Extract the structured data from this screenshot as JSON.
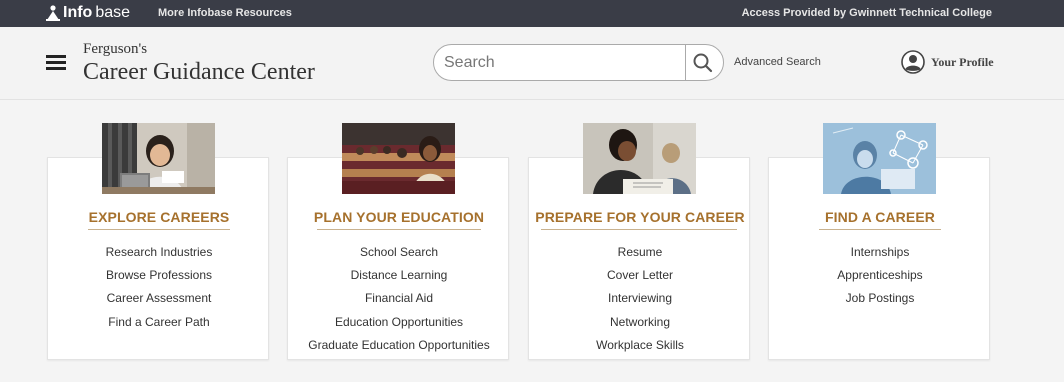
{
  "topbar": {
    "logo_bold": "Info",
    "logo_rest": "base",
    "more_resources": "More Infobase Resources",
    "access": "Access Provided by Gwinnett Technical College"
  },
  "header": {
    "brand_small": "Ferguson's",
    "brand_big": "Career Guidance Center",
    "search_placeholder": "Search",
    "advanced_search": "Advanced Search",
    "profile": "Your Profile"
  },
  "colors": {
    "topbar": "#3a3d47",
    "accent": "#a6712d",
    "background": "#f4f4f4"
  },
  "cards": [
    {
      "title": "EXPLORE CAREERS",
      "image": "student-studying-with-laptop-photo",
      "links": [
        "Research Industries",
        "Browse Professions",
        "Career Assessment",
        "Find a Career Path"
      ]
    },
    {
      "title": "PLAN YOUR EDUCATION",
      "image": "lecture-hall-students-photo",
      "links": [
        "School Search",
        "Distance Learning",
        "Financial Aid",
        "Education Opportunities",
        "Graduate Education Opportunities"
      ]
    },
    {
      "title": "PREPARE FOR YOUR CAREER",
      "image": "students-writing-at-desk-photo",
      "links": [
        "Resume",
        "Cover Letter",
        "Interviewing",
        "Networking",
        "Workplace Skills"
      ]
    },
    {
      "title": "FIND A CAREER",
      "image": "network-graphic-woman-photo",
      "links": [
        "Internships",
        "Apprenticeships",
        "Job Postings"
      ]
    }
  ]
}
